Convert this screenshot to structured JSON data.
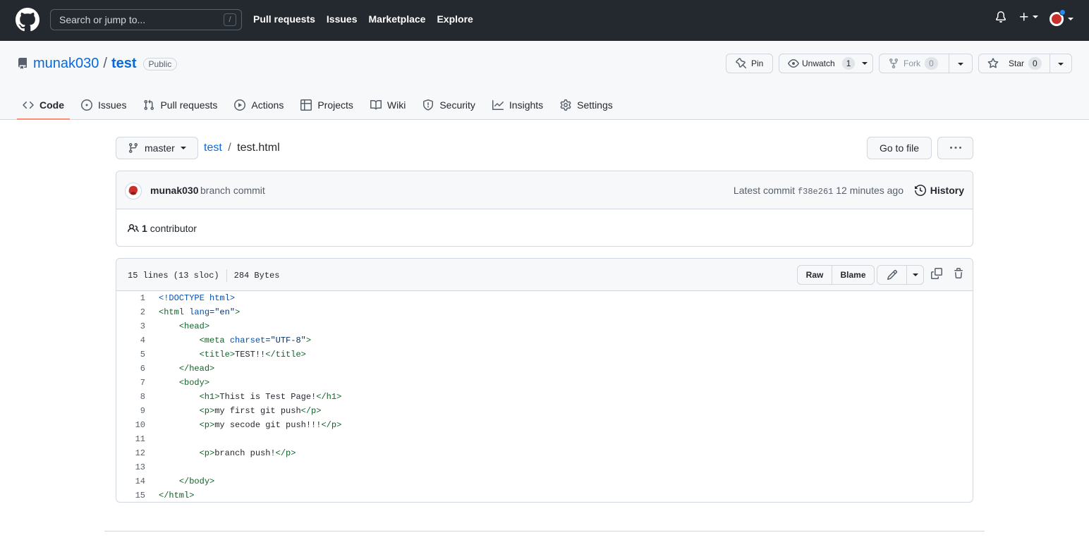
{
  "header": {
    "search_placeholder": "Search or jump to...",
    "search_key": "/",
    "nav": [
      "Pull requests",
      "Issues",
      "Marketplace",
      "Explore"
    ]
  },
  "repo": {
    "owner": "munak030",
    "separator": "/",
    "name": "test",
    "visibility": "Public",
    "pin_label": "Pin",
    "watch_label": "Unwatch",
    "watch_count": "1",
    "fork_label": "Fork",
    "fork_count": "0",
    "star_label": "Star",
    "star_count": "0"
  },
  "tabs": [
    {
      "label": "Code",
      "icon": "code-icon"
    },
    {
      "label": "Issues",
      "icon": "issue-opened-icon"
    },
    {
      "label": "Pull requests",
      "icon": "git-pull-request-icon"
    },
    {
      "label": "Actions",
      "icon": "play-icon"
    },
    {
      "label": "Projects",
      "icon": "table-icon"
    },
    {
      "label": "Wiki",
      "icon": "book-icon"
    },
    {
      "label": "Security",
      "icon": "shield-icon"
    },
    {
      "label": "Insights",
      "icon": "graph-icon"
    },
    {
      "label": "Settings",
      "icon": "gear-icon"
    }
  ],
  "file_nav": {
    "branch": "master",
    "breadcrumb_repo": "test",
    "breadcrumb_sep": "/",
    "breadcrumb_file": "test.html",
    "go_to_file": "Go to file"
  },
  "commit": {
    "author": "munak030",
    "message": "branch commit",
    "latest_label": "Latest commit",
    "sha": "f38e261",
    "time": "12 minutes ago",
    "history_label": "History",
    "contributor_count": "1",
    "contributor_label": "contributor"
  },
  "file": {
    "lines_info": "15 lines (13 sloc)",
    "size": "284 Bytes",
    "raw_label": "Raw",
    "blame_label": "Blame",
    "lines": [
      "<!DOCTYPE html>",
      "<html lang=\"en\">",
      "    <head>",
      "        <meta charset=\"UTF-8\">",
      "        <title>TEST!!</title>",
      "    </head>",
      "    <body>",
      "        <h1>Thist is Test Page!</h1>",
      "        <p>my first git push</p>",
      "        <p>my secode git push!!!</p>",
      "",
      "        <p>branch push!</p>",
      "",
      "    </body>",
      "</html>"
    ]
  },
  "colors": {
    "header_bg": "#24292f",
    "link": "#0969da",
    "active_tab_underline": "#fd8c73",
    "code_tag": "#116329",
    "code_string": "#0a3069",
    "code_attr": "#0550ae",
    "avatar_red": "#c9302c",
    "notification_dot": "#218bff"
  }
}
